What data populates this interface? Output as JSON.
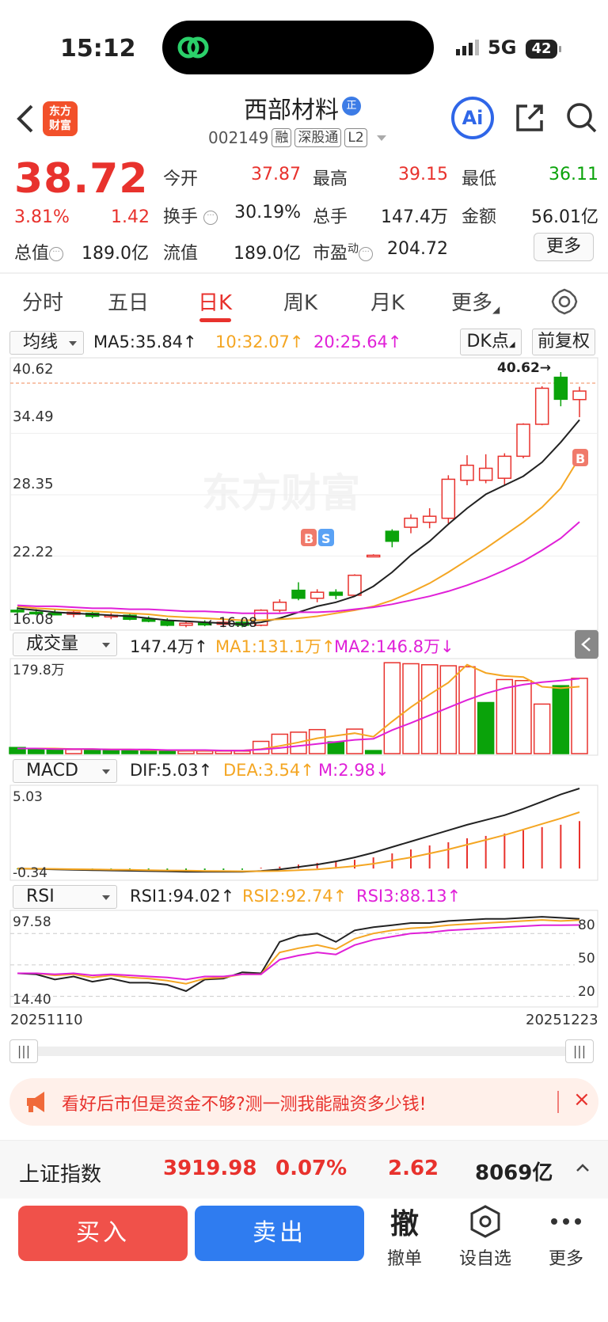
{
  "status_bar": {
    "time": "15:12",
    "network": "5G",
    "battery": "42"
  },
  "header": {
    "stock_name": "西部材料",
    "zheng_badge": "正",
    "code": "002149",
    "tags": [
      "融",
      "深股通",
      "L2"
    ],
    "logo_text_line1": "东方",
    "logo_text_line2": "财富",
    "ai_label": "Ai"
  },
  "quote": {
    "price": "38.72",
    "change_pct": "3.81%",
    "change": "1.42",
    "fields": {
      "open_label": "今开",
      "open": "37.87",
      "high_label": "最高",
      "high": "39.15",
      "low_label": "最低",
      "low": "36.11",
      "turnover_label": "换手",
      "turnover": "30.19%",
      "volume_label": "总手",
      "volume": "147.4万",
      "amount_label": "金额",
      "amount": "56.01亿",
      "mktcap_label": "总值",
      "mktcap": "189.0亿",
      "float_label": "流值",
      "float": "189.0亿",
      "pe_label": "市盈",
      "pe_sup": "动",
      "pe": "204.72"
    },
    "more_label": "更多"
  },
  "tabs": [
    "分时",
    "五日",
    "日K",
    "周K",
    "月K",
    "更多"
  ],
  "active_tab": "日K",
  "indicator_rows": {
    "ma": {
      "selector": "均线",
      "ma5": "MA5:35.84↑",
      "ma10": "10:32.07↑",
      "ma20": "20:25.64↑",
      "dk_button": "DK点",
      "adjust_button": "前复权"
    },
    "vol": {
      "selector": "成交量",
      "value": "147.4万↑",
      "ma1": "MA1:131.1万↑",
      "ma2": "MA2:146.8万↓"
    },
    "macd": {
      "selector": "MACD",
      "dif": "DIF:5.03↑",
      "dea": "DEA:3.54↑",
      "m": "M:2.98↓"
    },
    "rsi": {
      "selector": "RSI",
      "rsi1": "RSI1:94.02↑",
      "rsi2": "RSI2:92.74↑",
      "rsi3": "RSI3:88.13↑"
    }
  },
  "chart_labels": {
    "price_ticks": [
      "40.62",
      "34.49",
      "28.35",
      "22.22",
      "16.08"
    ],
    "max_marker": "40.62→",
    "min_marker": "←16.08",
    "watermark": "东方财富",
    "vol_top": "179.8万",
    "macd_top": "5.03",
    "macd_bottom": "-0.34",
    "rsi_top": "97.58",
    "rsi_bottom": "14.40",
    "rsi_levels": [
      "80",
      "50",
      "20"
    ],
    "date_start": "20251110",
    "date_end": "20251223",
    "buy_marker": "B",
    "sell_marker": "S"
  },
  "chart_data": [
    {
      "type": "candlestick",
      "title": "",
      "ylim": [
        16.08,
        40.62
      ],
      "x_range": [
        "20251110",
        "20251223"
      ],
      "candles": [
        {
          "o": 16.8,
          "h": 17.1,
          "l": 16.4,
          "c": 16.7
        },
        {
          "o": 16.6,
          "h": 16.9,
          "l": 16.3,
          "c": 16.5
        },
        {
          "o": 16.5,
          "h": 16.9,
          "l": 16.3,
          "c": 16.4
        },
        {
          "o": 16.4,
          "h": 16.8,
          "l": 16.1,
          "c": 16.6
        },
        {
          "o": 16.5,
          "h": 16.7,
          "l": 16.0,
          "c": 16.2
        },
        {
          "o": 16.2,
          "h": 16.5,
          "l": 15.9,
          "c": 16.3
        },
        {
          "o": 16.3,
          "h": 16.5,
          "l": 15.8,
          "c": 15.9
        },
        {
          "o": 15.9,
          "h": 16.2,
          "l": 15.6,
          "c": 15.7
        },
        {
          "o": 15.7,
          "h": 16.0,
          "l": 15.2,
          "c": 15.3
        },
        {
          "o": 15.3,
          "h": 15.7,
          "l": 15.1,
          "c": 15.5
        },
        {
          "o": 15.5,
          "h": 15.8,
          "l": 15.2,
          "c": 15.4
        },
        {
          "o": 15.4,
          "h": 15.8,
          "l": 15.1,
          "c": 15.6
        },
        {
          "o": 15.6,
          "h": 16.0,
          "l": 15.1,
          "c": 15.3
        },
        {
          "o": 15.3,
          "h": 16.9,
          "l": 15.2,
          "c": 16.8
        },
        {
          "o": 16.8,
          "h": 17.9,
          "l": 16.6,
          "c": 17.6
        },
        {
          "o": 18.8,
          "h": 19.6,
          "l": 17.8,
          "c": 18.0
        },
        {
          "o": 18.0,
          "h": 18.9,
          "l": 17.6,
          "c": 18.6
        },
        {
          "o": 18.6,
          "h": 18.9,
          "l": 17.9,
          "c": 18.3
        },
        {
          "o": 18.3,
          "h": 20.4,
          "l": 18.2,
          "c": 20.3
        },
        {
          "o": 22.3,
          "h": 22.4,
          "l": 22.1,
          "c": 22.3
        },
        {
          "o": 24.7,
          "h": 24.9,
          "l": 23.1,
          "c": 23.7
        },
        {
          "o": 25.1,
          "h": 26.4,
          "l": 24.5,
          "c": 26.0
        },
        {
          "o": 25.6,
          "h": 27.0,
          "l": 25.0,
          "c": 26.2
        },
        {
          "o": 26.0,
          "h": 30.3,
          "l": 25.5,
          "c": 29.9
        },
        {
          "o": 29.8,
          "h": 32.3,
          "l": 29.3,
          "c": 31.3
        },
        {
          "o": 29.8,
          "h": 32.4,
          "l": 29.5,
          "c": 31.0
        },
        {
          "o": 30.0,
          "h": 32.5,
          "l": 29.3,
          "c": 32.2
        },
        {
          "o": 32.2,
          "h": 35.5,
          "l": 32.0,
          "c": 35.4
        },
        {
          "o": 35.4,
          "h": 39.2,
          "l": 35.3,
          "c": 39.0
        },
        {
          "o": 40.1,
          "h": 40.62,
          "l": 37.2,
          "c": 37.9
        },
        {
          "o": 37.87,
          "h": 39.15,
          "l": 36.11,
          "c": 38.72
        }
      ],
      "series": [
        {
          "name": "MA5",
          "values": [
            17.0,
            16.8,
            16.6,
            16.5,
            16.4,
            16.3,
            16.2,
            16.0,
            15.8,
            15.7,
            15.6,
            15.5,
            15.4,
            15.6,
            16.0,
            16.6,
            17.2,
            17.6,
            18.2,
            19.2,
            20.6,
            22.3,
            23.7,
            25.4,
            27.0,
            28.4,
            29.3,
            30.2,
            31.6,
            33.6,
            35.84
          ]
        },
        {
          "name": "MA10",
          "values": [
            17.2,
            17.0,
            16.9,
            16.8,
            16.7,
            16.6,
            16.5,
            16.4,
            16.2,
            16.1,
            16.0,
            15.9,
            15.8,
            15.8,
            15.9,
            16.0,
            16.2,
            16.5,
            16.8,
            17.2,
            17.8,
            18.6,
            19.5,
            20.6,
            21.8,
            23.0,
            24.3,
            25.6,
            27.1,
            29.0,
            32.07
          ]
        },
        {
          "name": "MA20",
          "values": [
            17.3,
            17.2,
            17.2,
            17.1,
            17.0,
            17.0,
            16.9,
            16.9,
            16.8,
            16.7,
            16.7,
            16.6,
            16.5,
            16.5,
            16.5,
            16.6,
            16.6,
            16.7,
            16.9,
            17.1,
            17.4,
            17.8,
            18.2,
            18.7,
            19.3,
            20.0,
            20.8,
            21.7,
            22.8,
            24.0,
            25.64
          ]
        }
      ]
    },
    {
      "type": "bar",
      "title": "成交量",
      "ylim": [
        0,
        179.8
      ],
      "unit": "万",
      "values": [
        12,
        10,
        9,
        8,
        7,
        8,
        7,
        6,
        6,
        5,
        5,
        5,
        5,
        24,
        38,
        42,
        47,
        23,
        48,
        6,
        178,
        176,
        174,
        172,
        170,
        100,
        145,
        143,
        97,
        133,
        147.4
      ],
      "up": [
        false,
        false,
        false,
        true,
        false,
        false,
        false,
        false,
        false,
        true,
        true,
        true,
        true,
        true,
        true,
        true,
        true,
        false,
        true,
        false,
        true,
        true,
        true,
        true,
        true,
        false,
        true,
        true,
        true,
        false,
        true
      ],
      "series": [
        {
          "name": "MA1",
          "values": [
            10,
            10,
            10,
            9,
            9,
            8,
            8,
            7,
            7,
            6,
            6,
            6,
            6,
            9,
            15,
            22,
            30,
            35,
            40,
            33,
            63,
            91,
            116,
            139,
            174,
            158,
            152,
            150,
            131,
            128,
            131.1
          ]
        },
        {
          "name": "MA2",
          "values": [
            10,
            10,
            9,
            9,
            9,
            8,
            8,
            8,
            7,
            7,
            7,
            6,
            6,
            8,
            11,
            15,
            19,
            23,
            27,
            29,
            46,
            60,
            75,
            90,
            105,
            118,
            128,
            135,
            140,
            143,
            146.8
          ]
        }
      ]
    },
    {
      "type": "bar",
      "title": "MACD",
      "ylim": [
        -0.34,
        5.03
      ],
      "values": [
        -0.05,
        -0.06,
        -0.07,
        -0.07,
        -0.08,
        -0.08,
        -0.09,
        -0.1,
        -0.1,
        -0.1,
        -0.09,
        -0.09,
        -0.08,
        0.05,
        0.12,
        0.25,
        0.35,
        0.42,
        0.55,
        0.7,
        0.95,
        1.2,
        1.45,
        1.65,
        1.9,
        2.05,
        2.2,
        2.4,
        2.6,
        2.75,
        2.98
      ],
      "series": [
        {
          "name": "DIF",
          "values": [
            0.0,
            -0.02,
            -0.05,
            -0.08,
            -0.1,
            -0.12,
            -0.14,
            -0.16,
            -0.18,
            -0.2,
            -0.2,
            -0.2,
            -0.2,
            -0.15,
            -0.05,
            0.1,
            0.25,
            0.45,
            0.7,
            1.0,
            1.35,
            1.7,
            2.05,
            2.4,
            2.75,
            3.05,
            3.35,
            3.75,
            4.2,
            4.65,
            5.03
          ]
        },
        {
          "name": "DEA",
          "values": [
            0.0,
            -0.01,
            -0.02,
            -0.04,
            -0.05,
            -0.07,
            -0.08,
            -0.1,
            -0.12,
            -0.13,
            -0.15,
            -0.16,
            -0.17,
            -0.17,
            -0.15,
            -0.1,
            -0.05,
            0.05,
            0.15,
            0.3,
            0.5,
            0.7,
            0.95,
            1.2,
            1.5,
            1.8,
            2.1,
            2.45,
            2.8,
            3.15,
            3.54
          ]
        }
      ]
    },
    {
      "type": "line",
      "title": "RSI",
      "ylim": [
        14.4,
        97.58
      ],
      "series": [
        {
          "name": "RSI1",
          "values": [
            42,
            41,
            36,
            39,
            34,
            37,
            33,
            33,
            31,
            25,
            36,
            37,
            43,
            42,
            72,
            78,
            80,
            72,
            83,
            86,
            88,
            90,
            90,
            92,
            93,
            94,
            94,
            95,
            96,
            95,
            94.02
          ]
        },
        {
          "name": "RSI2",
          "values": [
            42,
            42,
            40,
            41,
            38,
            40,
            38,
            37,
            35,
            32,
            37,
            38,
            41,
            41,
            62,
            66,
            69,
            65,
            75,
            80,
            83,
            85,
            86,
            88,
            89,
            90,
            91,
            92,
            93,
            92,
            92.74
          ]
        },
        {
          "name": "RSI3",
          "values": [
            42,
            42,
            41,
            42,
            40,
            41,
            40,
            39,
            38,
            36,
            39,
            39,
            41,
            41,
            55,
            59,
            62,
            60,
            69,
            74,
            77,
            80,
            81,
            83,
            84,
            85,
            86,
            87,
            88,
            88,
            88.13
          ]
        }
      ]
    }
  ],
  "banner": {
    "text": "看好后市但是资金不够?测一测我能融资多少钱!",
    "close": "×"
  },
  "index_bar": {
    "name": "上证指数",
    "value": "3919.98",
    "pct": "0.07%",
    "change": "2.62",
    "amount": "8069亿"
  },
  "bottom_bar": {
    "buy": "买入",
    "sell": "卖出",
    "cancel_glyph": "撤",
    "cancel": "撤单",
    "watch": "设自选",
    "more": "更多"
  },
  "colors": {
    "up": "#e8322d",
    "down": "#0aa30a",
    "ma5": "#222222",
    "ma10": "#f4a623",
    "ma20": "#e020d8",
    "accent_blue": "#2f66e8"
  }
}
